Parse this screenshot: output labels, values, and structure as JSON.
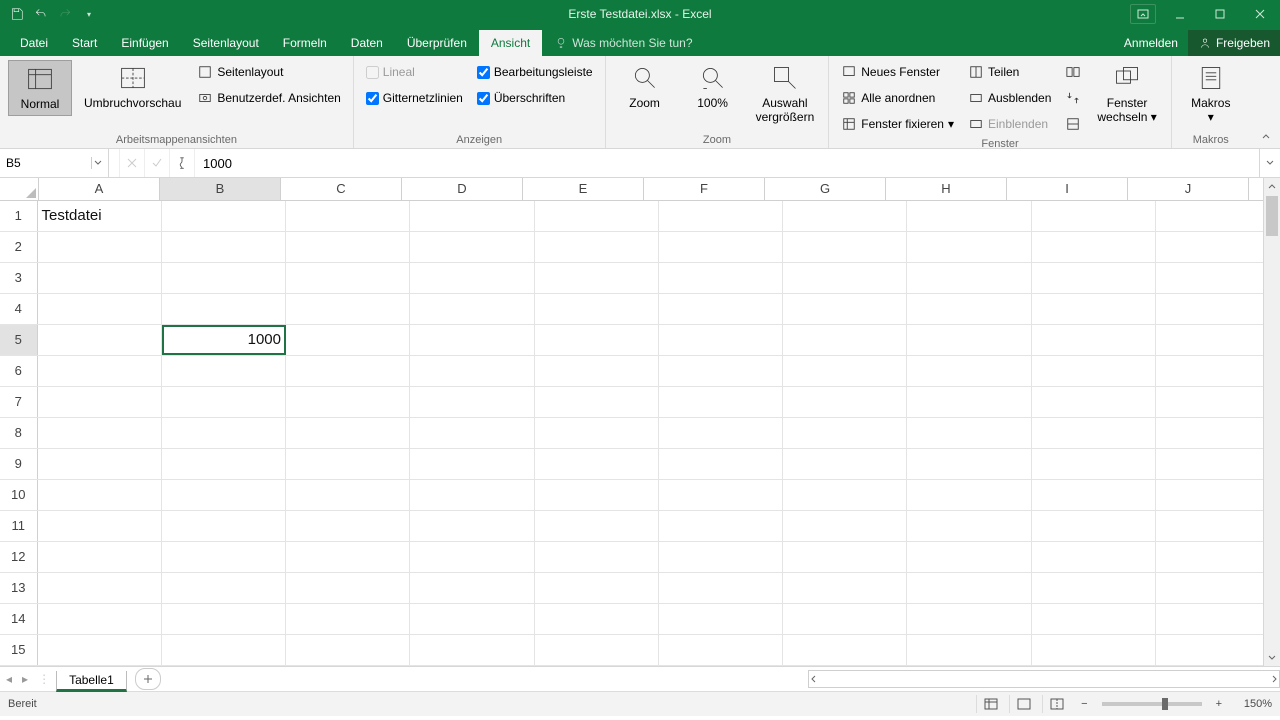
{
  "title": "Erste Testdatei.xlsx - Excel",
  "qat": {},
  "tabs": {
    "file": "Datei",
    "list": [
      "Start",
      "Einfügen",
      "Seitenlayout",
      "Formeln",
      "Daten",
      "Überprüfen",
      "Ansicht"
    ],
    "active": "Ansicht",
    "tellme": "Was möchten Sie tun?",
    "signin": "Anmelden",
    "share": "Freigeben"
  },
  "ribbon": {
    "views": {
      "normal": "Normal",
      "pagebreak": "Umbruchvorschau",
      "pagelayout": "Seitenlayout",
      "custom": "Benutzerdef. Ansichten",
      "group": "Arbeitsmappenansichten"
    },
    "show": {
      "ruler": "Lineal",
      "formulabar": "Bearbeitungsleiste",
      "gridlines": "Gitternetzlinien",
      "headings": "Überschriften",
      "group": "Anzeigen"
    },
    "zoom": {
      "zoom": "Zoom",
      "hundred": "100%",
      "selection1": "Auswahl",
      "selection2": "vergrößern",
      "group": "Zoom"
    },
    "window": {
      "neww": "Neues Fenster",
      "arrange": "Alle anordnen",
      "freeze": "Fenster fixieren",
      "split": "Teilen",
      "hide": "Ausblenden",
      "unhide": "Einblenden",
      "switch1": "Fenster",
      "switch2": "wechseln",
      "group": "Fenster"
    },
    "macros": {
      "macros": "Makros",
      "group": "Makros"
    }
  },
  "namebox": "B5",
  "formula": "1000",
  "columns": [
    "A",
    "B",
    "C",
    "D",
    "E",
    "F",
    "G",
    "H",
    "I",
    "J"
  ],
  "rows": 15,
  "cells": {
    "A1": {
      "v": "Testdatei",
      "align": "left"
    },
    "B5": {
      "v": "1000",
      "align": "right"
    }
  },
  "selection": {
    "col": "B",
    "row": 5
  },
  "sheets": {
    "active": "Tabelle1"
  },
  "status": {
    "ready": "Bereit",
    "zoom": "150%"
  }
}
